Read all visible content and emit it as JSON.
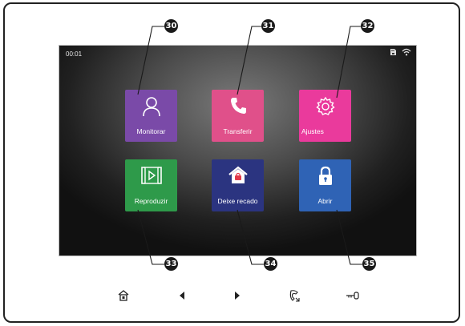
{
  "screen": {
    "clock": "00:01",
    "status_icons": [
      "sd-card-icon",
      "wifi-icon"
    ]
  },
  "tiles": [
    {
      "label": "Monitorar",
      "icon": "person-icon",
      "color": "#7a4aa8"
    },
    {
      "label": "Transferir",
      "icon": "phone-icon",
      "color": "#e0508a"
    },
    {
      "label": "Ajustes",
      "icon": "gear-icon",
      "color": "#ea3a9c"
    },
    {
      "label": "Reproduzir",
      "icon": "play-icon",
      "color": "#2e9a4a"
    },
    {
      "label": "Deixe recado",
      "icon": "house-message-icon",
      "color": "#2b3480"
    },
    {
      "label": "Abrir",
      "icon": "lock-icon",
      "color": "#2f63b5"
    }
  ],
  "callouts": [
    "30",
    "31",
    "32",
    "33",
    "34",
    "35"
  ],
  "buttons": [
    "home-icon",
    "left-arrow-icon",
    "right-arrow-icon",
    "call-icon",
    "key-icon"
  ]
}
